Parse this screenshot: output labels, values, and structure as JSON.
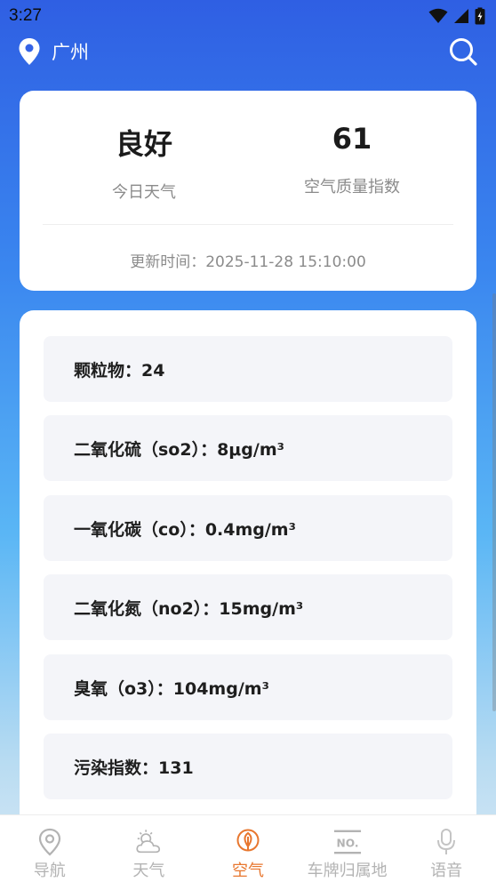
{
  "status_bar": {
    "time": "3:27"
  },
  "header": {
    "city": "广州"
  },
  "summary": {
    "quality_text": "良好",
    "quality_label": "今日天气",
    "aqi_value": "61",
    "aqi_label": "空气质量指数",
    "update_time": "更新时间：2025-11-28 15:10:00"
  },
  "pollutants": [
    {
      "text": "颗粒物：24"
    },
    {
      "text": "二氧化硫（so2）：8μg/m³"
    },
    {
      "text": "一氧化碳（co）：0.4mg/m³"
    },
    {
      "text": "二氧化氮（no2）：15mg/m³"
    },
    {
      "text": "臭氧（o3）：104mg/m³"
    },
    {
      "text": "污染指数：131"
    }
  ],
  "tabs": [
    {
      "label": "导航",
      "icon": "location-pin-icon",
      "active": false
    },
    {
      "label": "天气",
      "icon": "weather-icon",
      "active": false
    },
    {
      "label": "空气",
      "icon": "leaf-icon",
      "active": true
    },
    {
      "label": "车牌归属地",
      "icon": "license-plate-icon",
      "active": false
    },
    {
      "label": "语音",
      "icon": "microphone-icon",
      "active": false
    }
  ],
  "colors": {
    "accent": "#e8772f",
    "inactive": "#b3b3b3",
    "header_blue": "#2f5fe3"
  }
}
